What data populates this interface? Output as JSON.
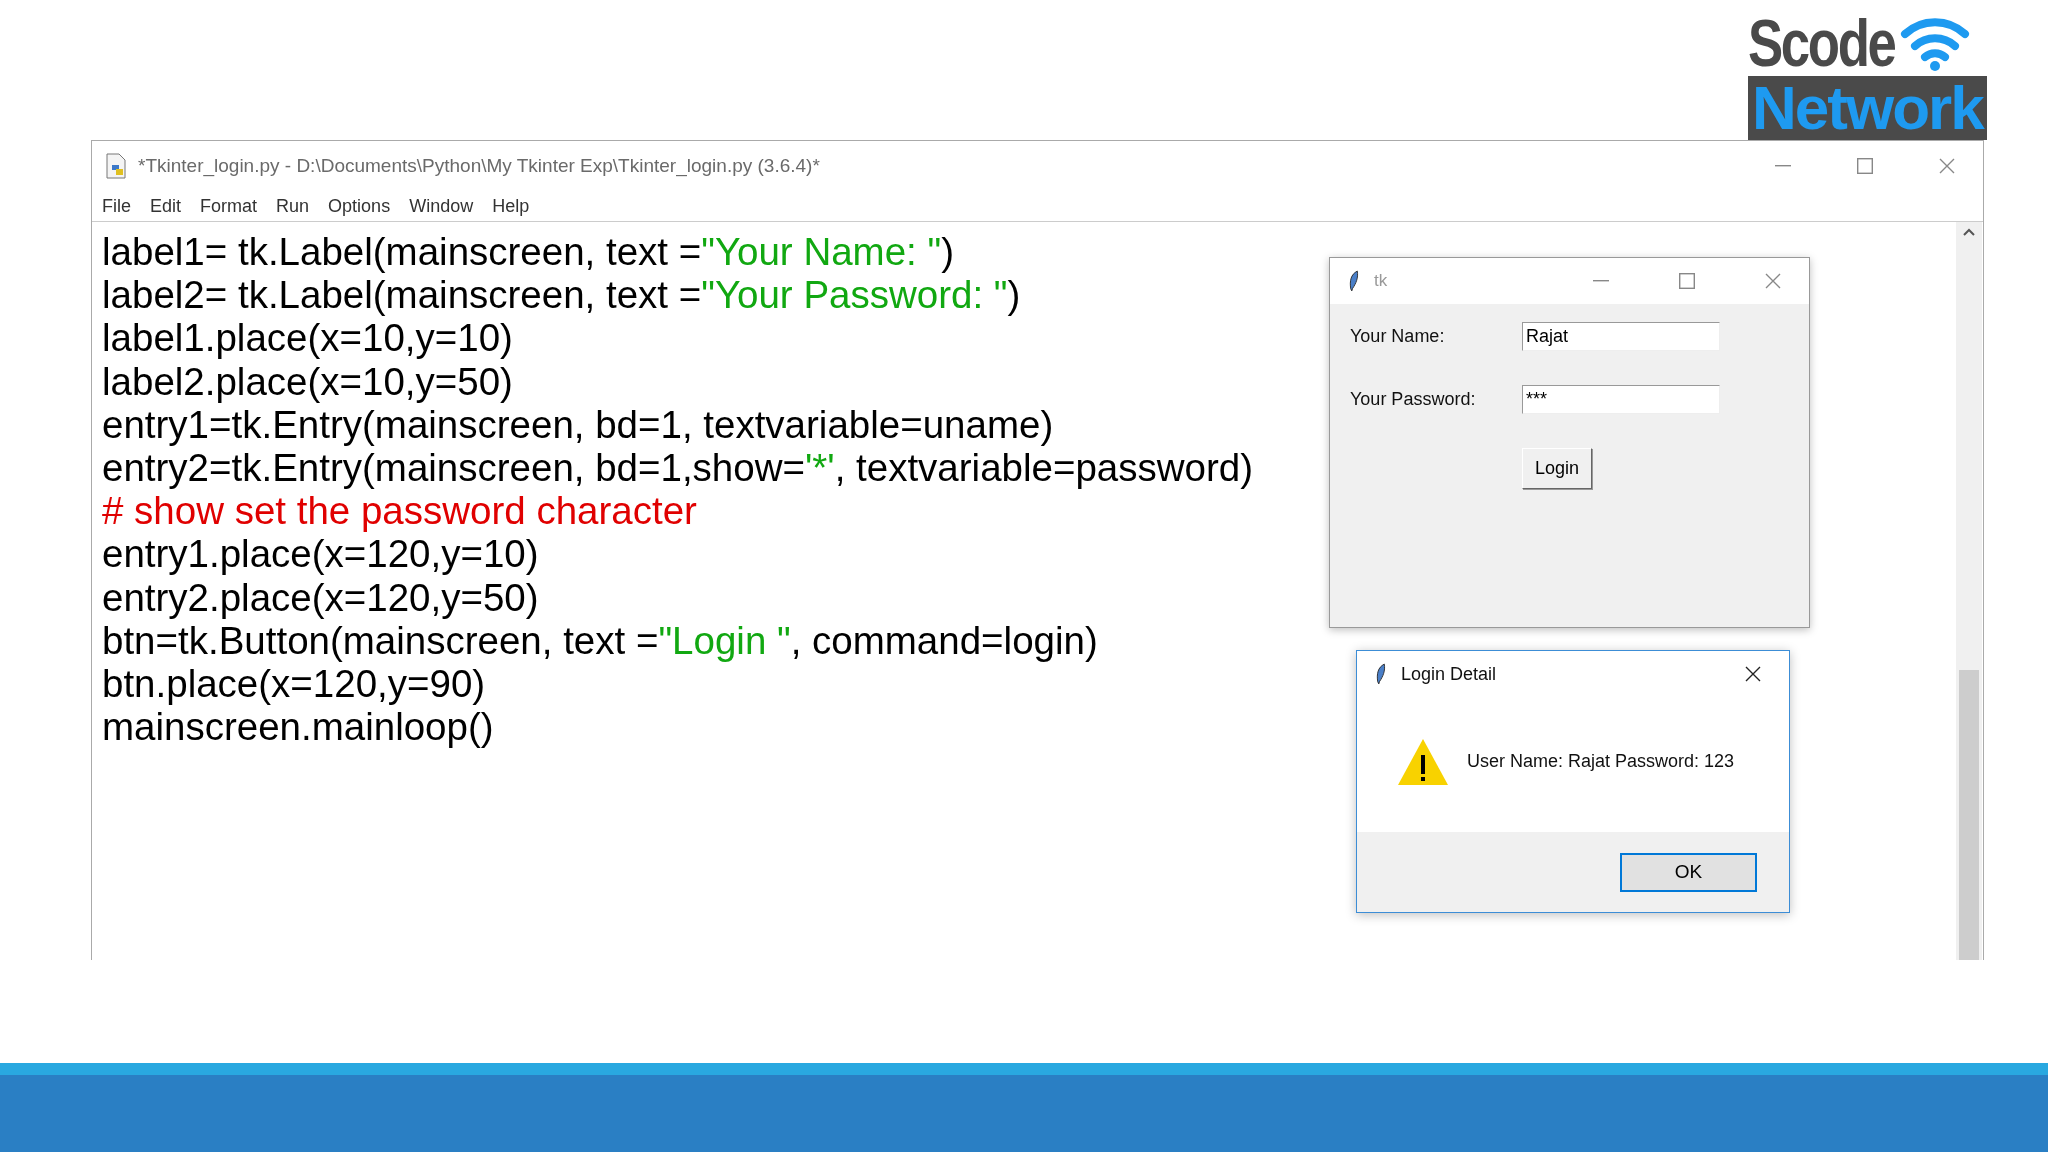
{
  "logo": {
    "top": "Scode",
    "bottom": "Network"
  },
  "editor": {
    "title": "*Tkinter_login.py - D:\\Documents\\Python\\My Tkinter Exp\\Tkinter_login.py (3.6.4)*",
    "menu": [
      "File",
      "Edit",
      "Format",
      "Run",
      "Options",
      "Window",
      "Help"
    ],
    "code_lines": [
      [
        {
          "kind": "code",
          "text": "label1= tk.Label(mainscreen, text ="
        },
        {
          "kind": "string",
          "text": "\"Your Name: \""
        },
        {
          "kind": "code",
          "text": ")"
        }
      ],
      [
        {
          "kind": "code",
          "text": "label2= tk.Label(mainscreen, text ="
        },
        {
          "kind": "string",
          "text": "\"Your Password: \""
        },
        {
          "kind": "code",
          "text": ")"
        }
      ],
      [
        {
          "kind": "code",
          "text": "label1.place(x=10,y=10)"
        }
      ],
      [
        {
          "kind": "code",
          "text": "label2.place(x=10,y=50)"
        }
      ],
      [
        {
          "kind": "code",
          "text": "entry1=tk.Entry(mainscreen, bd=1, textvariable=uname)"
        }
      ],
      [
        {
          "kind": "code",
          "text": "entry2=tk.Entry(mainscreen, bd=1,show="
        },
        {
          "kind": "string",
          "text": "'*'"
        },
        {
          "kind": "code",
          "text": ", textvariable=password)"
        }
      ],
      [
        {
          "kind": "comment",
          "text": "# show set the password character"
        }
      ],
      [
        {
          "kind": "code",
          "text": "entry1.place(x=120,y=10)"
        }
      ],
      [
        {
          "kind": "code",
          "text": "entry2.place(x=120,y=50)"
        }
      ],
      [
        {
          "kind": "code",
          "text": "btn=tk.Button(mainscreen, text ="
        },
        {
          "kind": "string",
          "text": "\"Login \""
        },
        {
          "kind": "code",
          "text": ", command=login)"
        }
      ],
      [
        {
          "kind": "code",
          "text": "btn.place(x=120,y=90)"
        }
      ],
      [
        {
          "kind": "code",
          "text": "mainscreen.mainloop()"
        }
      ]
    ]
  },
  "tk_window": {
    "title": "tk",
    "fields": [
      {
        "label": "Your Name:",
        "value": "Rajat"
      },
      {
        "label": "Your Password:",
        "value": "***"
      }
    ],
    "button": "Login"
  },
  "dialog": {
    "title": "Login Detail",
    "message": "User Name: Rajat Password: 123",
    "button": "OK"
  }
}
